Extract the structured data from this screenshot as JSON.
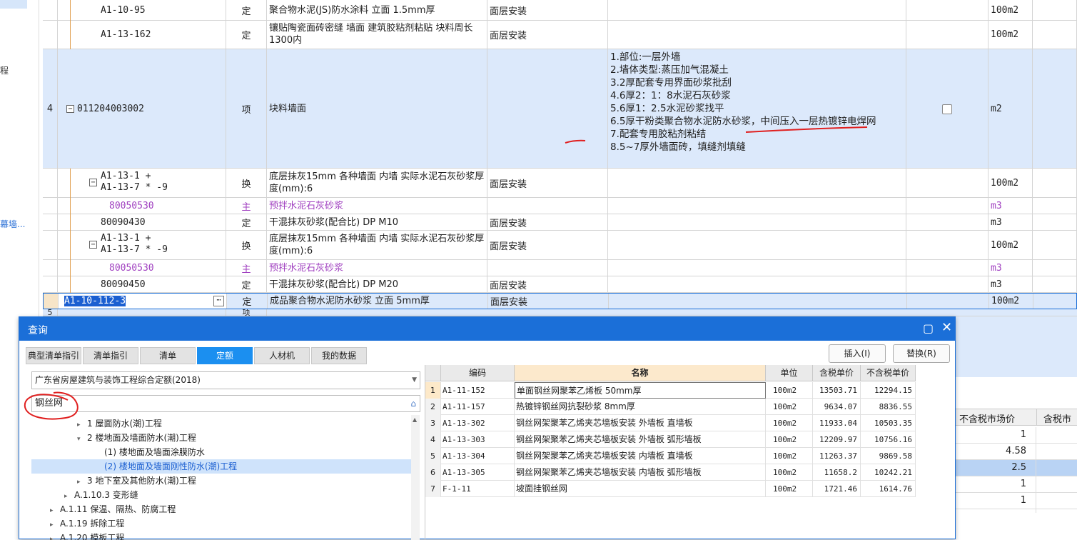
{
  "left_strip": {
    "text1": "程",
    "text2": "幕墙..."
  },
  "grid": {
    "rows": [
      {
        "num": "",
        "code": "A1-10-95",
        "type": "定",
        "name": "聚合物水泥(JS)防水涂料 立面 1.5mm厚",
        "desc": "面层安装",
        "features": "",
        "unit": "100m2"
      },
      {
        "num": "",
        "code": "A1-13-162",
        "type": "定",
        "name": "镶贴陶瓷面砖密缝 墙面 建筑胶粘剂粘贴 块料周长1300内",
        "desc": "面层安装",
        "features": "",
        "unit": "100m2"
      },
      {
        "num": "4",
        "code": "011204003002",
        "type": "项",
        "name": "块料墙面",
        "desc": "",
        "features": [
          "1.部位:一层外墙",
          "2.墙体类型:蒸压加气混凝土",
          "3.2厚配套专用界面砂浆批刮",
          "4.6厚2：1：8水泥石灰砂浆",
          "5.6厚1：2.5水泥砂浆找平",
          "6.5厚干粉类聚合物水泥防水砂浆，中间压入一层热镀锌电焊网",
          "7.配套专用胶粘剂粘结",
          "8.5~7厚外墙面砖，填缝剂填缝"
        ],
        "unit": "m2"
      },
      {
        "num": "",
        "code": "A1-13-1 +\nA1-13-7 * -9",
        "type": "换",
        "name": "底层抹灰15mm 各种墙面 内墙  实际水泥石灰砂浆厚度(mm):6",
        "desc": "面层安装",
        "features": "",
        "unit": "100m2"
      },
      {
        "num": "",
        "code": "80050530",
        "type": "主",
        "name": "预拌水泥石灰砂浆",
        "desc": "",
        "features": "",
        "unit": "m3"
      },
      {
        "num": "",
        "code": "80090430",
        "type": "定",
        "name": "干混抹灰砂浆(配合比) DP M10",
        "desc": "面层安装",
        "features": "",
        "unit": "m3"
      },
      {
        "num": "",
        "code": "A1-13-1 +\nA1-13-7 * -9",
        "type": "换",
        "name": "底层抹灰15mm 各种墙面 内墙  实际水泥石灰砂浆厚度(mm):6",
        "desc": "面层安装",
        "features": "",
        "unit": "100m2"
      },
      {
        "num": "",
        "code": "80050530",
        "type": "主",
        "name": "预拌水泥石灰砂浆",
        "desc": "",
        "features": "",
        "unit": "m3"
      },
      {
        "num": "",
        "code": "80090450",
        "type": "定",
        "name": "干混抹灰砂浆(配合比) DP M20",
        "desc": "面层安装",
        "features": "",
        "unit": "m3"
      },
      {
        "num": "",
        "code": "A1-10-112-3",
        "type": "定",
        "name": "成品聚合物水泥防水砂浆 立面 5mm厚",
        "desc": "面层安装",
        "features": "",
        "unit": "100m2"
      },
      {
        "num": "5",
        "code": "",
        "type": "项",
        "name": "",
        "desc": "",
        "features": "",
        "unit": ""
      }
    ]
  },
  "right_panel": {
    "header1": "不含税市场价",
    "header2": "含税市",
    "values": [
      "1",
      "4.58",
      "2.5",
      "1",
      "1"
    ]
  },
  "dialog": {
    "title": "查询",
    "tabs": [
      "典型清单指引",
      "清单指引",
      "清单",
      "定额",
      "人材机",
      "我的数据"
    ],
    "active_tab": "定额",
    "insert_button": "插入(I)",
    "replace_button": "替换(R)",
    "combo_value": "广东省房屋建筑与装饰工程综合定额(2018)",
    "search_value": "钢丝网",
    "tree": [
      {
        "label": "1 屋面防水(潮)工程",
        "level": 3,
        "arrow": "▸"
      },
      {
        "label": "2 楼地面及墙面防水(潮)工程",
        "level": 3,
        "arrow": "▾"
      },
      {
        "label": "(1) 楼地面及墙面涂膜防水",
        "level": 4,
        "arrow": ""
      },
      {
        "label": "(2) 楼地面及墙面刚性防水(潮)工程",
        "level": 4,
        "arrow": ""
      },
      {
        "label": "3 地下室及其他防水(潮)工程",
        "level": 3,
        "arrow": "▸"
      },
      {
        "label": "A.1.10.3 变形缝",
        "level": 2,
        "arrow": "▸"
      },
      {
        "label": "A.1.11 保温、隔热、防腐工程",
        "level": 1,
        "arrow": "▸"
      },
      {
        "label": "A.1.19 拆除工程",
        "level": 1,
        "arrow": "▸"
      },
      {
        "label": "A.1.20 模板工程",
        "level": 1,
        "arrow": "▸"
      }
    ],
    "results": {
      "headers": [
        "编码",
        "名称",
        "单位",
        "含税单价",
        "不含税单价"
      ],
      "rows": [
        {
          "idx": "1",
          "code": "A1-11-152",
          "name": "单面钢丝网聚苯乙烯板 50mm厚",
          "unit": "100m2",
          "tax": "13503.71",
          "notax": "12294.15"
        },
        {
          "idx": "2",
          "code": "A1-11-157",
          "name": "热镀锌钢丝网抗裂砂浆 8mm厚",
          "unit": "100m2",
          "tax": "9634.07",
          "notax": "8836.55"
        },
        {
          "idx": "3",
          "code": "A1-13-302",
          "name": "钢丝网架聚苯乙烯夹芯墙板安装 外墙板 直墙板",
          "unit": "100m2",
          "tax": "11933.04",
          "notax": "10503.35"
        },
        {
          "idx": "4",
          "code": "A1-13-303",
          "name": "钢丝网架聚苯乙烯夹芯墙板安装 外墙板 弧形墙板",
          "unit": "100m2",
          "tax": "12209.97",
          "notax": "10756.16"
        },
        {
          "idx": "5",
          "code": "A1-13-304",
          "name": "钢丝网架聚苯乙烯夹芯墙板安装 内墙板 直墙板",
          "unit": "100m2",
          "tax": "11263.37",
          "notax": "9869.58"
        },
        {
          "idx": "6",
          "code": "A1-13-305",
          "name": "钢丝网架聚苯乙烯夹芯墙板安装 内墙板 弧形墙板",
          "unit": "100m2",
          "tax": "11658.2",
          "notax": "10242.21"
        },
        {
          "idx": "7",
          "code": "F-1-11",
          "name": "坡面挂钢丝网",
          "unit": "100m2",
          "tax": "1721.46",
          "notax": "1614.76"
        }
      ]
    }
  },
  "colors": {
    "accent": "#1b6fd8",
    "row_highlight": "#dce9fb",
    "main_material": "#a040c0",
    "annotation": "#e02020"
  }
}
